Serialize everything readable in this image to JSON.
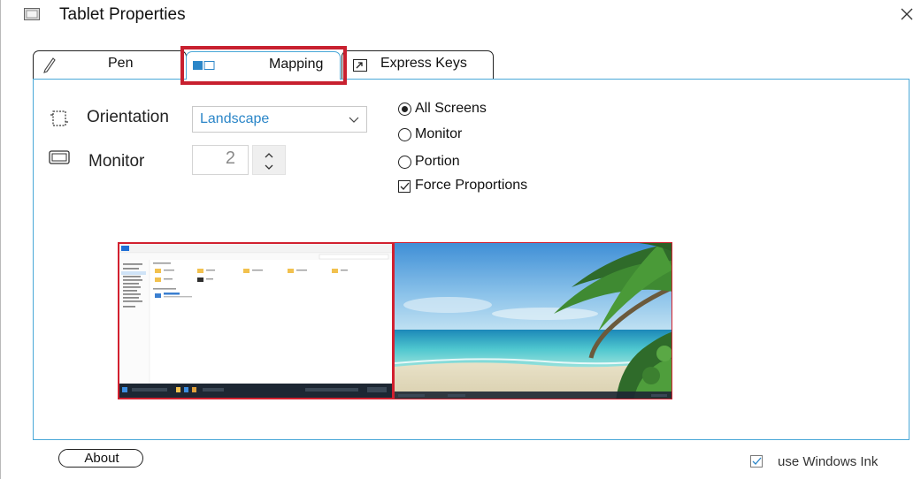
{
  "window": {
    "title": "Tablet Properties",
    "title_icon": "tablet-icon",
    "close_icon": "close-icon"
  },
  "tabs": [
    {
      "label": "Pen",
      "icon": "pen-icon",
      "selected": false
    },
    {
      "label": "Mapping",
      "icon": "mapping-icon",
      "selected": true
    },
    {
      "label": "Express Keys",
      "icon": "express-keys-icon",
      "selected": false
    }
  ],
  "mapping": {
    "orientation_label": "Orientation",
    "orientation_value": "Landscape",
    "monitor_label": "Monitor",
    "monitor_value": "2",
    "scope_options": [
      {
        "label": "All Screens",
        "selected": true
      },
      {
        "label": "Monitor",
        "selected": false
      },
      {
        "label": "Portion",
        "selected": false
      }
    ],
    "force_proportions_label": "Force Proportions",
    "force_proportions_checked": true
  },
  "footer": {
    "about_label": "About",
    "windows_ink_label": "use Windows Ink",
    "windows_ink_checked": true
  },
  "colors": {
    "accent": "#4aa8d8",
    "highlight": "#c8202f",
    "select_text": "#2b86c8"
  }
}
